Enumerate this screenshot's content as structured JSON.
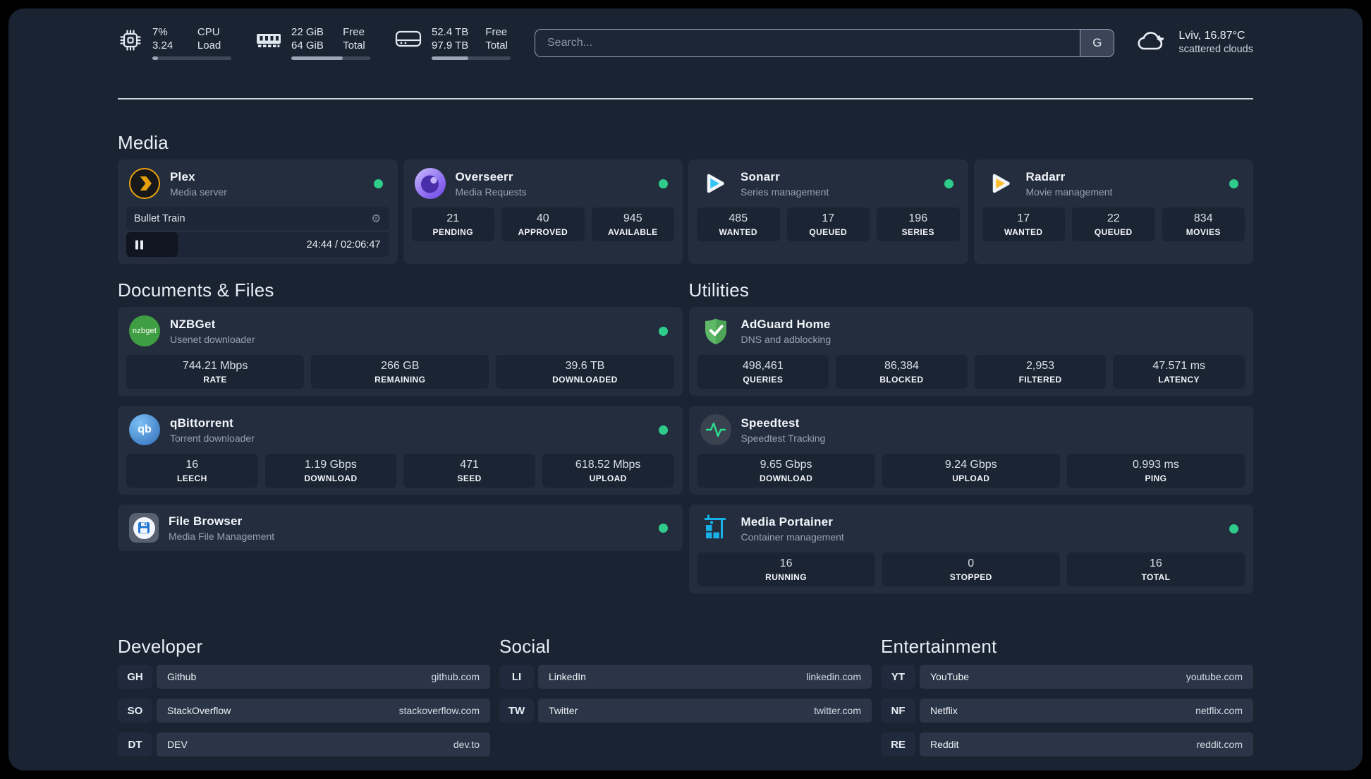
{
  "header": {
    "stats": [
      {
        "value1": "7%",
        "value2": "3.24",
        "label1": "CPU",
        "label2": "Load",
        "progress_pct": 7
      },
      {
        "value1": "22 GiB",
        "value2": "64 GiB",
        "label1": "Free",
        "label2": "Total",
        "progress_pct": 65
      },
      {
        "value1": "52.4 TB",
        "value2": "97.9 TB",
        "label1": "Free",
        "label2": "Total",
        "progress_pct": 46
      }
    ],
    "search": {
      "placeholder": "Search...",
      "engine_label": "G"
    },
    "weather": {
      "location_temp": "Lviv, 16.87°C",
      "condition": "scattered clouds"
    }
  },
  "sections": {
    "media": {
      "title": "Media",
      "apps": [
        {
          "name": "Plex",
          "desc": "Media server",
          "online": true,
          "player": {
            "now_playing": "Bullet Train",
            "time_display": "24:44 / 02:06:47",
            "progress_pct": 19.5
          }
        },
        {
          "name": "Overseerr",
          "desc": "Media Requests",
          "online": true,
          "stats": [
            {
              "value": "21",
              "label": "PENDING"
            },
            {
              "value": "40",
              "label": "APPROVED"
            },
            {
              "value": "945",
              "label": "AVAILABLE"
            }
          ]
        },
        {
          "name": "Sonarr",
          "desc": "Series management",
          "online": true,
          "stats": [
            {
              "value": "485",
              "label": "WANTED"
            },
            {
              "value": "17",
              "label": "QUEUED"
            },
            {
              "value": "196",
              "label": "SERIES"
            }
          ]
        },
        {
          "name": "Radarr",
          "desc": "Movie management",
          "online": true,
          "stats": [
            {
              "value": "17",
              "label": "WANTED"
            },
            {
              "value": "22",
              "label": "QUEUED"
            },
            {
              "value": "834",
              "label": "MOVIES"
            }
          ]
        }
      ]
    },
    "documents": {
      "title": "Documents & Files",
      "apps": [
        {
          "name": "NZBGet",
          "desc": "Usenet downloader",
          "online": true,
          "logo_text": "nzbget",
          "stats": [
            {
              "value": "744.21 Mbps",
              "label": "RATE"
            },
            {
              "value": "266 GB",
              "label": "REMAINING"
            },
            {
              "value": "39.6 TB",
              "label": "DOWNLOADED"
            }
          ]
        },
        {
          "name": "qBittorrent",
          "desc": "Torrent downloader",
          "online": true,
          "logo_text": "qb",
          "stats": [
            {
              "value": "16",
              "label": "LEECH"
            },
            {
              "value": "1.19 Gbps",
              "label": "DOWNLOAD"
            },
            {
              "value": "471",
              "label": "SEED"
            },
            {
              "value": "618.52 Mbps",
              "label": "UPLOAD"
            }
          ]
        },
        {
          "name": "File Browser",
          "desc": "Media File Management",
          "online": true
        }
      ]
    },
    "utilities": {
      "title": "Utilities",
      "apps": [
        {
          "name": "AdGuard Home",
          "desc": "DNS and adblocking",
          "stats": [
            {
              "value": "498,461",
              "label": "QUERIES"
            },
            {
              "value": "86,384",
              "label": "BLOCKED"
            },
            {
              "value": "2,953",
              "label": "FILTERED"
            },
            {
              "value": "47.571 ms",
              "label": "LATENCY"
            }
          ]
        },
        {
          "name": "Speedtest",
          "desc": "Speedtest Tracking",
          "stats": [
            {
              "value": "9.65 Gbps",
              "label": "DOWNLOAD"
            },
            {
              "value": "9.24 Gbps",
              "label": "UPLOAD"
            },
            {
              "value": "0.993 ms",
              "label": "PING"
            }
          ]
        },
        {
          "name": "Media Portainer",
          "desc": "Container management",
          "online": true,
          "stats": [
            {
              "value": "16",
              "label": "RUNNING"
            },
            {
              "value": "0",
              "label": "STOPPED"
            },
            {
              "value": "16",
              "label": "TOTAL"
            }
          ]
        }
      ]
    }
  },
  "links": {
    "developer": {
      "title": "Developer",
      "items": [
        {
          "abbr": "GH",
          "name": "Github",
          "host": "github.com"
        },
        {
          "abbr": "SO",
          "name": "StackOverflow",
          "host": "stackoverflow.com"
        },
        {
          "abbr": "DT",
          "name": "DEV",
          "host": "dev.to"
        }
      ]
    },
    "social": {
      "title": "Social",
      "items": [
        {
          "abbr": "LI",
          "name": "LinkedIn",
          "host": "linkedin.com"
        },
        {
          "abbr": "TW",
          "name": "Twitter",
          "host": "twitter.com"
        }
      ]
    },
    "entertainment": {
      "title": "Entertainment",
      "items": [
        {
          "abbr": "YT",
          "name": "YouTube",
          "host": "youtube.com"
        },
        {
          "abbr": "NF",
          "name": "Netflix",
          "host": "netflix.com"
        },
        {
          "abbr": "RE",
          "name": "Reddit",
          "host": "reddit.com"
        }
      ]
    }
  },
  "colors": {
    "status_online": "#2ecb8b",
    "plex": "#e8a00d",
    "sonarr": "#35c5f4",
    "radarr": "#fdbd2c",
    "nzbget": "#3f9e42",
    "qbittorrent": "#2f6cb8",
    "adguard": "#5fb867",
    "speedtest_pulse": "#2be08f",
    "portainer": "#18b0e8",
    "overseerr": "#8f6ff2"
  }
}
